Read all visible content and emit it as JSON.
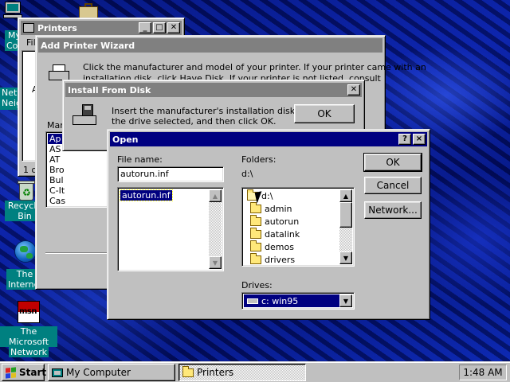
{
  "desktop": {
    "icons": [
      {
        "id": "my-computer",
        "label": "My Computer"
      },
      {
        "id": "network-neighborhood",
        "label": "Network Neighborhood"
      },
      {
        "id": "recycle-bin",
        "label": "Recycle Bin"
      },
      {
        "id": "the-internet",
        "label": "The Internet"
      },
      {
        "id": "msn",
        "label_line1": "The Microsoft",
        "label_line2": "Network",
        "logo": "msn"
      }
    ]
  },
  "printers_window": {
    "title": "Printers",
    "menu_first": "File",
    "list_peek": [
      "A"
    ],
    "status_peek": "1 o"
  },
  "wizard": {
    "title": "Add Printer Wizard",
    "text_line1": "Click the manufacturer and model of your printer. If your printer came with an",
    "text_line2": "installation disk, click Have Disk. If your printer is not listed, consult your printer",
    "manufacturers_label": "Manufacturers:",
    "manufacturers": [
      "Ap",
      "AS",
      "AT",
      "Bro",
      "Bul",
      "C-It",
      "Cas"
    ]
  },
  "install_from_disk": {
    "title": "Install From Disk",
    "text_line1": "Insert the manufacturer's installation disk into",
    "text_line2": "the drive selected, and then click OK.",
    "ok_label": "OK"
  },
  "open_dialog": {
    "title": "Open",
    "help_btn": "?",
    "close_btn": "×",
    "file_name_label": "File name:",
    "file_name_value": "autorun.inf",
    "files": [
      "autorun.inf"
    ],
    "folders_label": "Folders:",
    "current_path": "d:\\",
    "folders": [
      {
        "name": "d:\\",
        "open": true
      },
      {
        "name": "admin"
      },
      {
        "name": "autorun"
      },
      {
        "name": "datalink"
      },
      {
        "name": "demos"
      },
      {
        "name": "drivers"
      }
    ],
    "drives_label": "Drives:",
    "drive_selected": "c: win95",
    "ok_label": "OK",
    "cancel_label": "Cancel",
    "network_label": "Network..."
  },
  "taskbar": {
    "start_label": "Start",
    "tasks": [
      {
        "label": "My Computer",
        "pressed": false
      },
      {
        "label": "Printers",
        "pressed": true
      }
    ],
    "clock": "1:48 AM"
  },
  "colors": {
    "active_title": "#000080",
    "inactive_title": "#808080",
    "face": "#c0c0c0",
    "selection": "#000080"
  }
}
